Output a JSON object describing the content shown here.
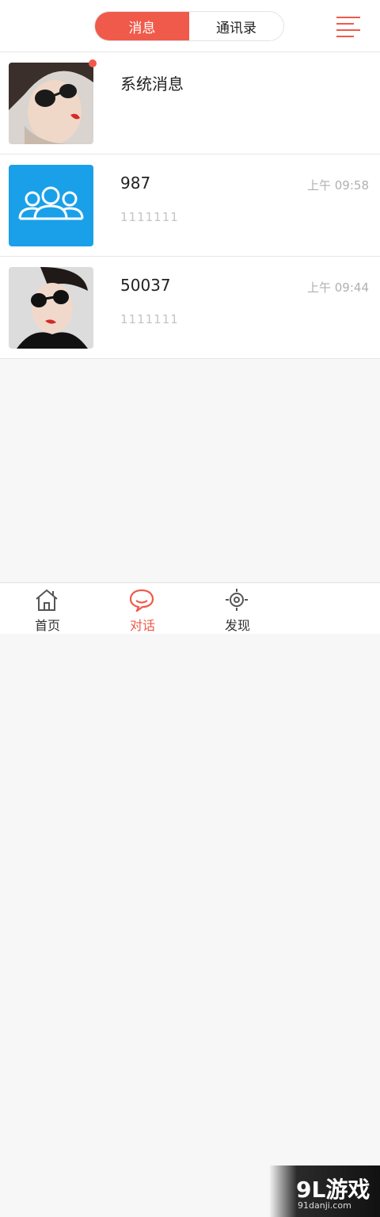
{
  "header": {
    "tabs": [
      {
        "label": "消息",
        "active": true
      },
      {
        "label": "通讯录",
        "active": false
      }
    ],
    "menu_icon": "menu-icon"
  },
  "conversations": [
    {
      "title": "系统消息",
      "avatar": "photo-woman-sunglasses",
      "unread": true,
      "time": "",
      "preview": ""
    },
    {
      "title": "987",
      "avatar": "group-icon",
      "unread": false,
      "time": "上午 09:58",
      "preview": "1111111"
    },
    {
      "title": "50037",
      "avatar": "photo-woman-sunglasses",
      "unread": false,
      "time": "上午 09:44",
      "preview": "1111111"
    }
  ],
  "tabbar": {
    "items": [
      {
        "label": "首页",
        "icon": "home-icon",
        "active": false
      },
      {
        "label": "对话",
        "icon": "chat-icon",
        "active": true
      },
      {
        "label": "发现",
        "icon": "compass-icon",
        "active": false
      }
    ]
  },
  "watermark": {
    "brand": "9L游戏",
    "site": "91danji.com"
  },
  "colors": {
    "accent": "#f05a4a",
    "group_avatar_bg": "#1aa0e8"
  }
}
